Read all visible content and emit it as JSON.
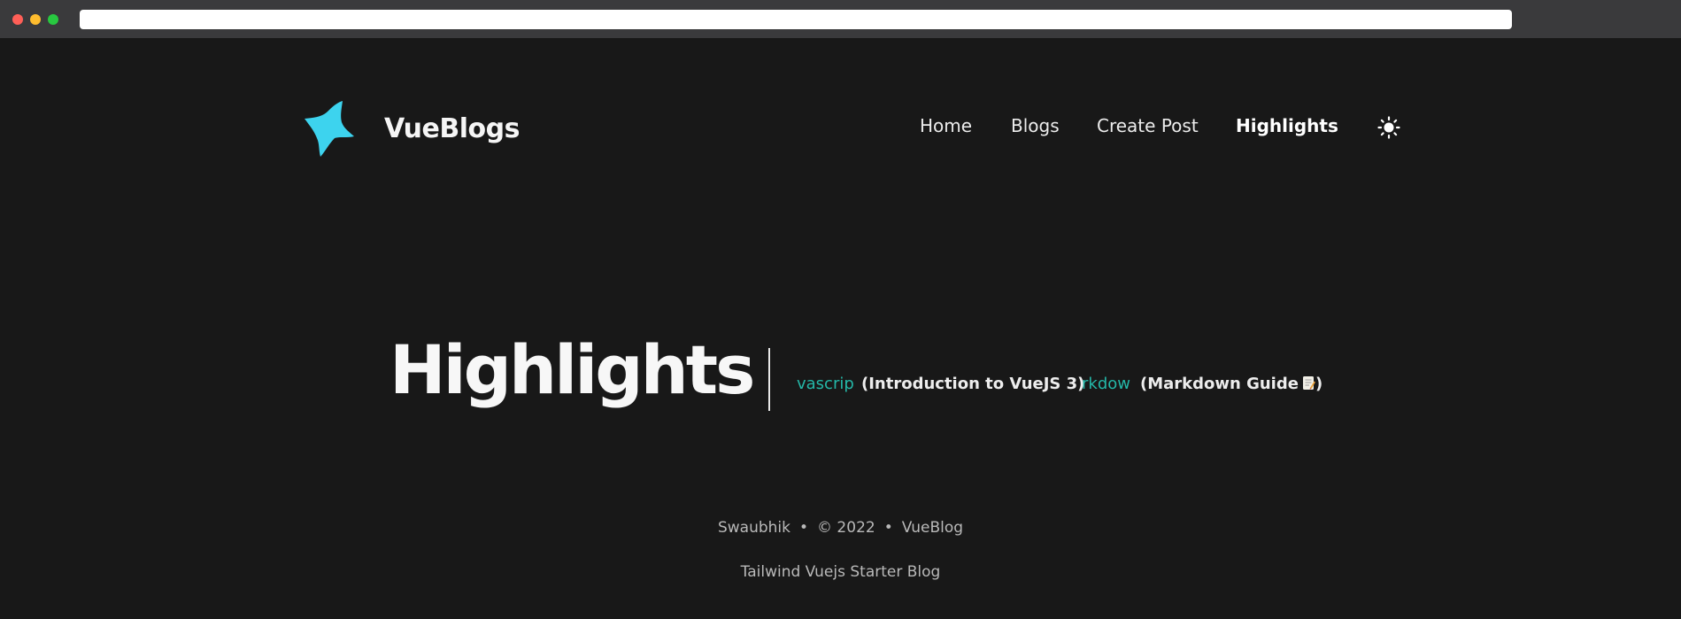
{
  "browser": {
    "address_value": "",
    "controls": [
      "close",
      "minimize",
      "maximize"
    ]
  },
  "header": {
    "brand": "VueBlogs",
    "logo_icon": "sparkle-star-icon",
    "logo_color": "#3dd3ee",
    "nav": [
      {
        "label": "Home",
        "active": false
      },
      {
        "label": "Blogs",
        "active": false
      },
      {
        "label": "Create Post",
        "active": false
      },
      {
        "label": "Highlights",
        "active": true
      }
    ],
    "theme_toggle_icon": "sun-icon"
  },
  "main": {
    "title": "Highlights",
    "highlights": [
      {
        "link_text": "vascrip",
        "title": "(Introduction to VueJS 3)"
      },
      {
        "link_text": "rkdow",
        "title": "(Markdown Guide",
        "icon": "memo-icon",
        "suffix": ")"
      }
    ],
    "accent_color": "#24b8a8"
  },
  "footer": {
    "author": "Swaubhik",
    "separator": "•",
    "copyright": "© 2022",
    "site": "VueBlog",
    "tagline": "Tailwind Vuejs Starter Blog"
  }
}
